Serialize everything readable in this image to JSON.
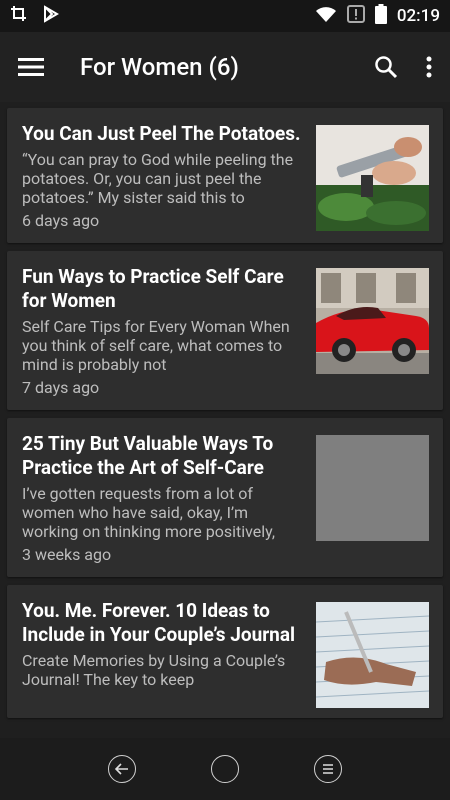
{
  "status": {
    "time": "02:19"
  },
  "appbar": {
    "title": "For Women (6)"
  },
  "articles": [
    {
      "title": "You Can Just Peel The Potatoes.",
      "excerpt": "“You can pray to God while peeling the potatoes. Or, you can just peel the potatoes.” My sister said this to",
      "time": "6 days ago",
      "thumb": "cooking-photo"
    },
    {
      "title": "Fun Ways to Practice Self Care for Women",
      "excerpt": "Self Care Tips for Every Woman When you think of self care, what comes to mind is probably not",
      "time": "7 days ago",
      "thumb": "red-car-photo"
    },
    {
      "title": "25 Tiny But Valuable Ways To Practice the Art of Self-Care",
      "excerpt": "I’ve gotten requests from a lot of women who have said, okay, I’m working on thinking more positively,",
      "time": "3 weeks ago",
      "thumb": "gray-placeholder"
    },
    {
      "title": "You. Me. Forever. 10 Ideas to Include in Your Couple’s Journal",
      "excerpt": "Create Memories by Using a Couple’s Journal! The key to keep",
      "time": "",
      "thumb": "writing-journal-photo"
    }
  ]
}
